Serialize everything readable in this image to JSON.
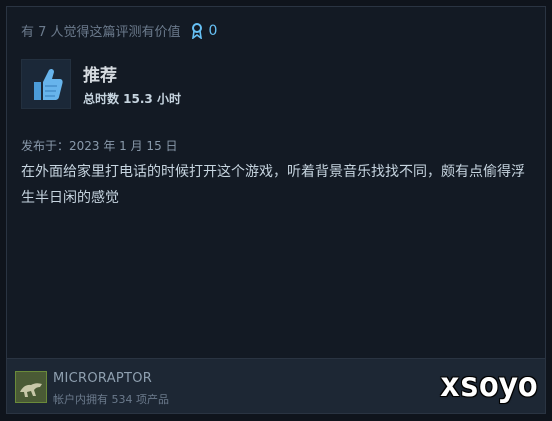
{
  "header": {
    "helpful_text": "有 7 人觉得这篇评测有价值",
    "award_count": "0",
    "award_icon": "award-ribbon-icon"
  },
  "review": {
    "thumb_icon": "thumbs-up-icon",
    "recommendation": "推荐",
    "hours": "总时数 15.3 小时",
    "posted": "发布于：2023 年 1 月 15 日",
    "text": "在外面给家里打电话的时候打开这个游戏，听着背景音乐找找不同，颇有点偷得浮生半日闲的感觉"
  },
  "author": {
    "avatar_icon": "dinosaur-avatar",
    "name": "MICRORAPTOR",
    "owned": "帐户内拥有 534 项产品"
  },
  "watermark": "xsoyo",
  "colors": {
    "background": "#0f141c",
    "card": "#131a24",
    "footer": "#1d2734",
    "accent": "#67c1f5",
    "thumb": "#4b9bd8"
  }
}
